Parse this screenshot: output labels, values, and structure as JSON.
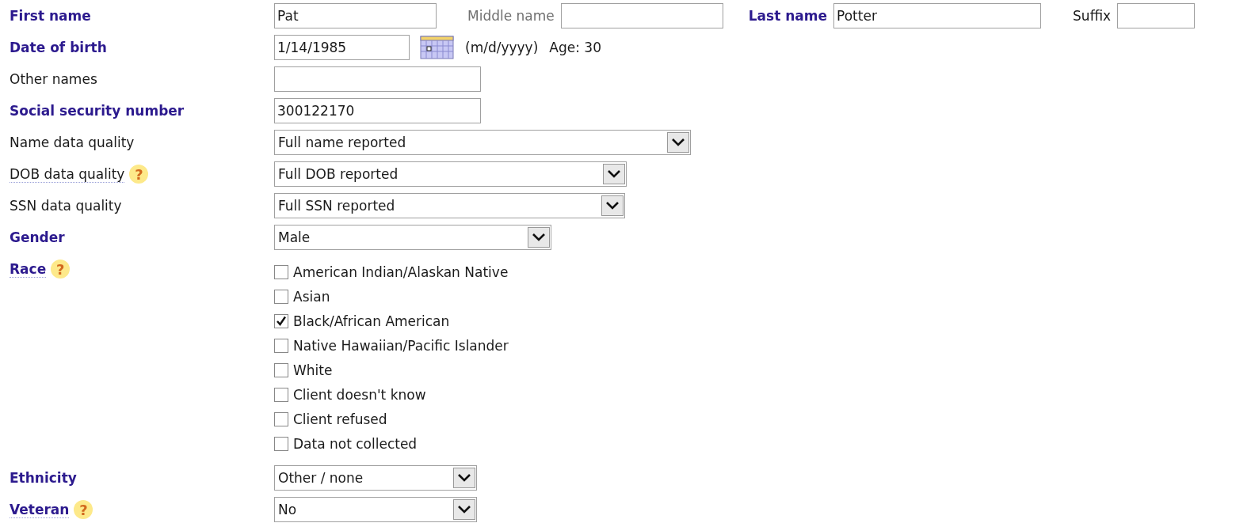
{
  "header_row": [
    {
      "label": "First name",
      "required": true,
      "muted": false,
      "value": "Pat"
    },
    {
      "label": "Middle name",
      "required": false,
      "muted": true
    },
    {
      "label": "Last name",
      "required": true,
      "muted": false,
      "value": "Potter"
    },
    {
      "label": "Suffix",
      "required": false,
      "muted": false
    }
  ],
  "fields": [
    {
      "kind": "date",
      "label": "Date of birth",
      "required": true,
      "value": "1/14/1985",
      "format": "(m/d/yyyy)",
      "age": "Age: 30"
    },
    {
      "kind": "text",
      "label": "Other names",
      "required": false
    },
    {
      "kind": "text",
      "label": "Social security number",
      "required": true,
      "value": "300122170"
    },
    {
      "kind": "select",
      "label": "Name data quality",
      "required": false,
      "value": "Full name reported"
    },
    {
      "kind": "select",
      "label": "DOB data quality",
      "required": false,
      "help": "?",
      "value": "Full DOB reported"
    },
    {
      "kind": "select",
      "label": "SSN data quality",
      "required": false,
      "value": "Full SSN reported"
    },
    {
      "kind": "select",
      "label": "Gender",
      "required": true,
      "value": "Male"
    },
    {
      "kind": "checklist",
      "label": "Race",
      "required": true,
      "help": "?",
      "options": [
        {
          "label": "American Indian/Alaskan Native",
          "checked": false
        },
        {
          "label": "Asian",
          "checked": false
        },
        {
          "label": "Black/African American",
          "checked": true
        },
        {
          "label": "Native Hawaiian/Pacific Islander",
          "checked": false
        },
        {
          "label": "White",
          "checked": false
        },
        {
          "label": "Client doesn't know",
          "checked": false
        },
        {
          "label": "Client refused",
          "checked": false
        },
        {
          "label": "Data not collected",
          "checked": false
        }
      ]
    },
    {
      "kind": "select",
      "label": "Ethnicity",
      "required": true,
      "value": "Other / none"
    },
    {
      "kind": "select",
      "label": "Veteran",
      "required": true,
      "help": "?",
      "value": "No"
    }
  ]
}
